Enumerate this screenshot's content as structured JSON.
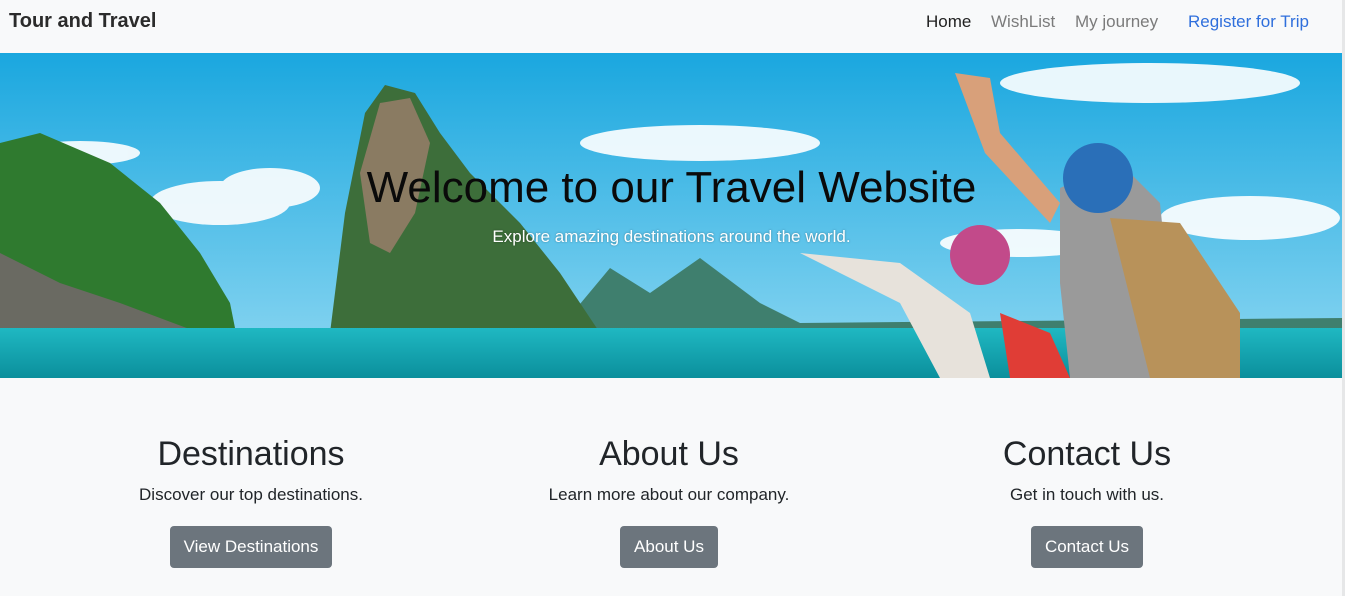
{
  "navbar": {
    "brand": "Tour and Travel",
    "links": [
      {
        "label": "Home"
      },
      {
        "label": "WishList"
      },
      {
        "label": "My journey"
      },
      {
        "label": "Register for Trip"
      }
    ]
  },
  "hero": {
    "title": "Welcome to our Travel Website",
    "subtitle": "Explore amazing destinations around the world."
  },
  "cards": [
    {
      "title": "Destinations",
      "text": "Discover our top destinations.",
      "button": "View Destinations"
    },
    {
      "title": "About Us",
      "text": "Learn more about our company.",
      "button": "About Us"
    },
    {
      "title": "Contact Us",
      "text": "Get in touch with us.",
      "button": "Contact Us"
    }
  ],
  "colors": {
    "background": "#f8f9fa",
    "link_active": "#1f1f1f",
    "link_muted": "#7b7b7b",
    "link_primary": "#2f6fdc",
    "button": "#6c757d"
  }
}
